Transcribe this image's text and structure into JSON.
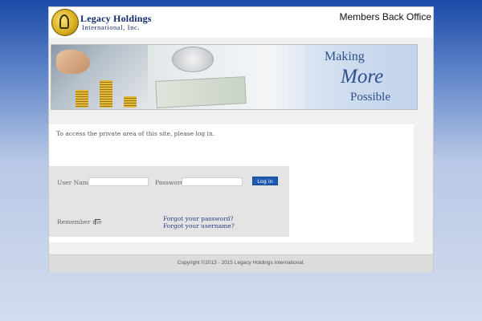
{
  "header": {
    "logo_line1": "Legacy Holdings",
    "logo_line2": "International, Inc.",
    "title": "Members Back Office"
  },
  "banner": {
    "slogan_line1": "Making",
    "slogan_line2": "More",
    "slogan_line3": "Possible"
  },
  "login": {
    "intro": "To access the private area of this site, please log in.",
    "username_label": "User Name",
    "username_value": "",
    "password_label": "Password",
    "password_value": "",
    "button_label": "Log in",
    "remember_label": "Remember me",
    "remember_checked": false,
    "forgot_password": "Forgot your password?",
    "forgot_username": "Forgot your username?"
  },
  "footer": {
    "copyright": "Copyright ©2013 - 2015 Legacy Holdings International."
  },
  "colors": {
    "accent": "#1f5bb0",
    "background_top": "#1a4aa6",
    "background_bottom": "#d3dcef",
    "link": "#2a3f86"
  }
}
